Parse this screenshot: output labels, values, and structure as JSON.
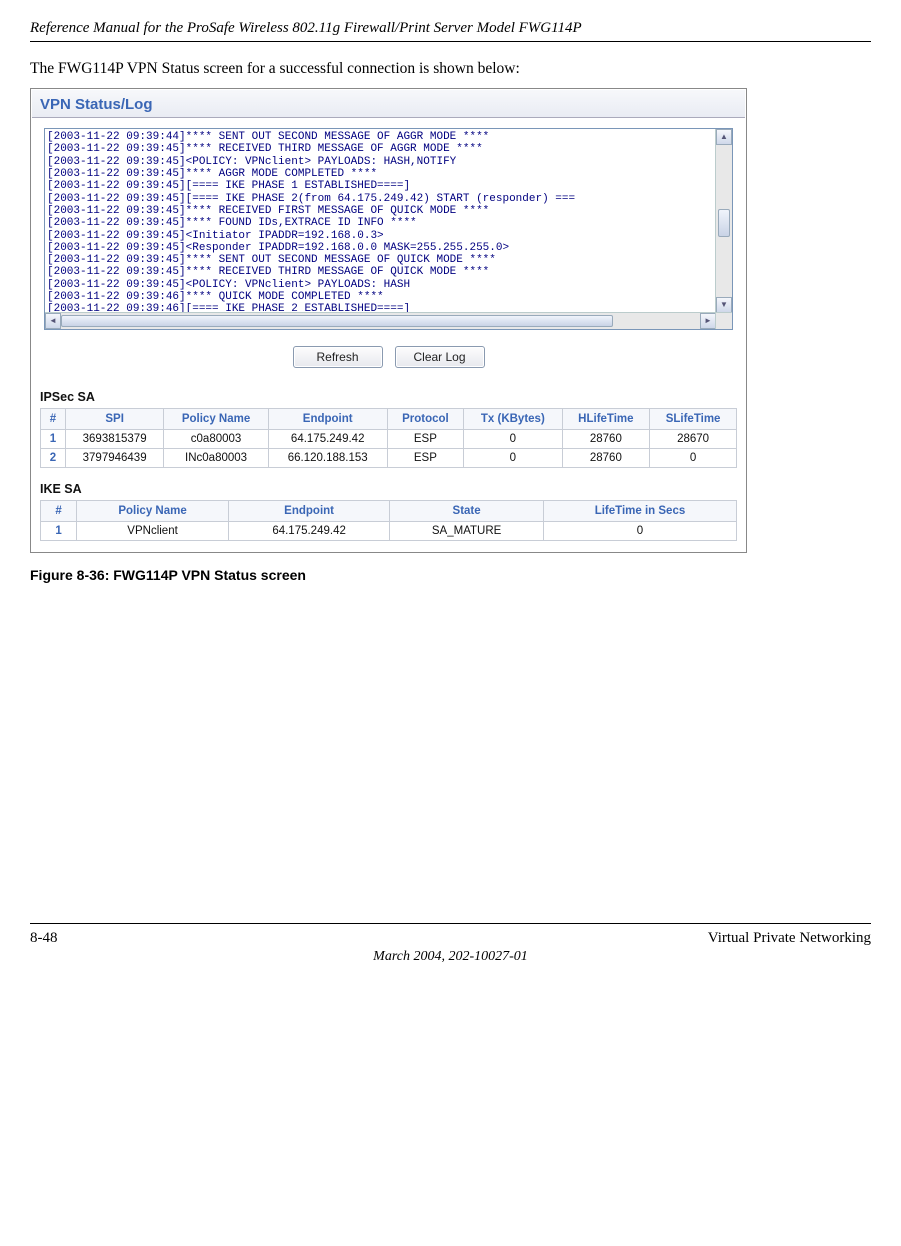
{
  "header": {
    "title": "Reference Manual for the ProSafe Wireless 802.11g  Firewall/Print Server Model FWG114P"
  },
  "intro": "The FWG114P VPN Status screen for a successful connection is shown below:",
  "panel": {
    "title": "VPN Status/Log"
  },
  "log_lines": [
    "[2003-11-22 09:39:44]**** SENT OUT SECOND MESSAGE OF AGGR MODE ****",
    "[2003-11-22 09:39:45]**** RECEIVED  THIRD MESSAGE OF AGGR MODE ****",
    "[2003-11-22 09:39:45]<POLICY: VPNclient> PAYLOADS: HASH,NOTIFY",
    "[2003-11-22 09:39:45]**** AGGR MODE COMPLETED ****",
    "[2003-11-22 09:39:45][==== IKE PHASE 1 ESTABLISHED====]",
    "[2003-11-22 09:39:45][==== IKE PHASE 2(from 64.175.249.42) START (responder) ===",
    "[2003-11-22 09:39:45]**** RECEIVED  FIRST MESSAGE OF QUICK MODE ****",
    "[2003-11-22 09:39:45]**** FOUND IDs,EXTRACE ID INFO ****",
    "[2003-11-22 09:39:45]<Initiator IPADDR=192.168.0.3>",
    "[2003-11-22 09:39:45]<Responder IPADDR=192.168.0.0 MASK=255.255.255.0>",
    "[2003-11-22 09:39:45]**** SENT OUT SECOND MESSAGE OF QUICK MODE ****",
    "[2003-11-22 09:39:45]**** RECEIVED  THIRD MESSAGE OF QUICK MODE ****",
    "[2003-11-22 09:39:45]<POLICY: VPNclient> PAYLOADS: HASH",
    "[2003-11-22 09:39:46]**** QUICK MODE COMPLETED ****",
    "[2003-11-22 09:39:46][==== IKE PHASE 2 ESTABLISHED====]"
  ],
  "buttons": {
    "refresh": "Refresh",
    "clear": "Clear Log"
  },
  "ipsec": {
    "label": "IPSec SA",
    "headers": [
      "#",
      "SPI",
      "Policy Name",
      "Endpoint",
      "Protocol",
      "Tx (KBytes)",
      "HLifeTime",
      "SLifeTime"
    ],
    "rows": [
      {
        "n": "1",
        "spi": "3693815379",
        "policy": "c0a80003",
        "endpoint": "64.175.249.42",
        "proto": "ESP",
        "tx": "0",
        "hl": "28760",
        "sl": "28670"
      },
      {
        "n": "2",
        "spi": "3797946439",
        "policy": "INc0a80003",
        "endpoint": "66.120.188.153",
        "proto": "ESP",
        "tx": "0",
        "hl": "28760",
        "sl": "0"
      }
    ]
  },
  "ike": {
    "label": "IKE SA",
    "headers": [
      "#",
      "Policy Name",
      "Endpoint",
      "State",
      "LifeTime in Secs"
    ],
    "rows": [
      {
        "n": "1",
        "policy": "VPNclient",
        "endpoint": "64.175.249.42",
        "state": "SA_MATURE",
        "life": "0"
      }
    ]
  },
  "figure": {
    "label": "Figure 8-36:  FWG114P VPN Status screen"
  },
  "footer": {
    "left": "8-48",
    "right": "Virtual Private Networking",
    "center": "March 2004, 202-10027-01"
  }
}
